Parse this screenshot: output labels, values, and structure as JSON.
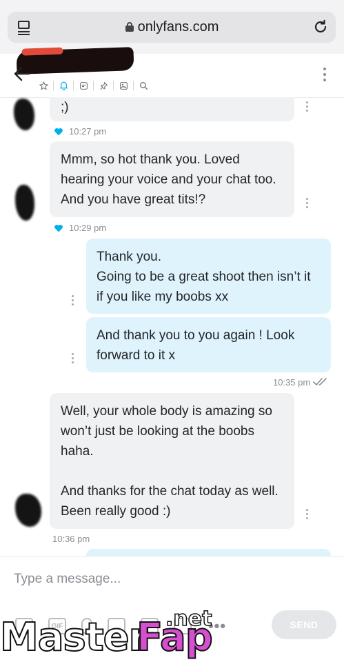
{
  "browser": {
    "url": "onlyfans.com"
  },
  "chat": {
    "messages": [
      {
        "text": ";)",
        "direction": "incoming"
      },
      {
        "time": "10:27 pm",
        "liked": true
      },
      {
        "text": "Mmm, so hot thank you. Loved\nhearing your voice and your chat too.\nAnd you have great tits!?",
        "direction": "incoming"
      },
      {
        "time": "10:29 pm",
        "liked": true
      },
      {
        "text": "Thank you.\nGoing to be a great shoot then isn’t it\nif you like my boobs xx",
        "direction": "outgoing"
      },
      {
        "text": "And thank you to you again ! Look\nforward to it x",
        "direction": "outgoing"
      },
      {
        "time": "10:35 pm",
        "read": true
      },
      {
        "text": "Well, your whole body is amazing so\nwon’t just be looking at the boobs\nhaha.\n\nAnd thanks for the chat today as well.\nBeen really good :)",
        "direction": "incoming"
      },
      {
        "time": "10:36 pm"
      }
    ]
  },
  "composer": {
    "placeholder": "Type a message...",
    "send_label": "SEND",
    "gif_label": "GIF",
    "more_label": "•••"
  },
  "watermark": {
    "brand_part1": "Master",
    "brand_part2": "Fap",
    "brand_tld": ".net"
  },
  "colors": {
    "accent": "#00aff0",
    "incoming_bubble": "#eff1f3",
    "outgoing_bubble": "#def3fc",
    "timestamp": "#8a8c93",
    "watermark_pink": "#d64fd0"
  },
  "icons": {
    "tabs": "tabs-icon",
    "lock": "lock-icon",
    "reload": "reload-icon",
    "back": "back-arrow-icon",
    "star": "star-icon",
    "bell": "bell-icon",
    "notes": "note-icon",
    "pin": "pin-icon",
    "image": "image-icon",
    "search": "search-icon",
    "heart": "heart-icon",
    "read": "double-check-icon",
    "more": "kebab-icon"
  }
}
